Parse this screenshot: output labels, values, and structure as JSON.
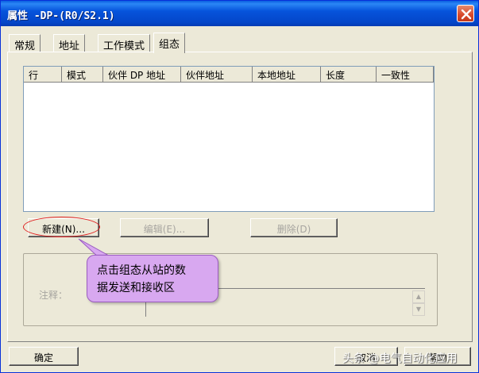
{
  "window": {
    "title": "属性 -DP-(R0/S2.1)"
  },
  "tabs": [
    {
      "label": "常规"
    },
    {
      "label": "地址"
    },
    {
      "label": "工作模式"
    },
    {
      "label": "组态"
    }
  ],
  "active_tab": "组态",
  "table": {
    "columns": [
      "行",
      "模式",
      "伙伴 DP 地址",
      "伙伴地址",
      "本地地址",
      "长度",
      "一致性"
    ],
    "rows": []
  },
  "buttons": {
    "new": "新建(N)...",
    "edit": "编辑(E)...",
    "delete": "删除(D)",
    "ok": "确定",
    "cancel": "取消",
    "help": "帮助"
  },
  "comment": {
    "label": "注释：",
    "value": ""
  },
  "annotation": {
    "line1": "点击组态从站的数",
    "line2": "据发送和接收区"
  },
  "watermark": "头条 @电气自动化应用",
  "colors": {
    "titlebar": "#0654dc",
    "dialog_bg": "#ece9d8",
    "callout_bg": "#d8a8f0",
    "highlight_ellipse": "#e02020"
  }
}
